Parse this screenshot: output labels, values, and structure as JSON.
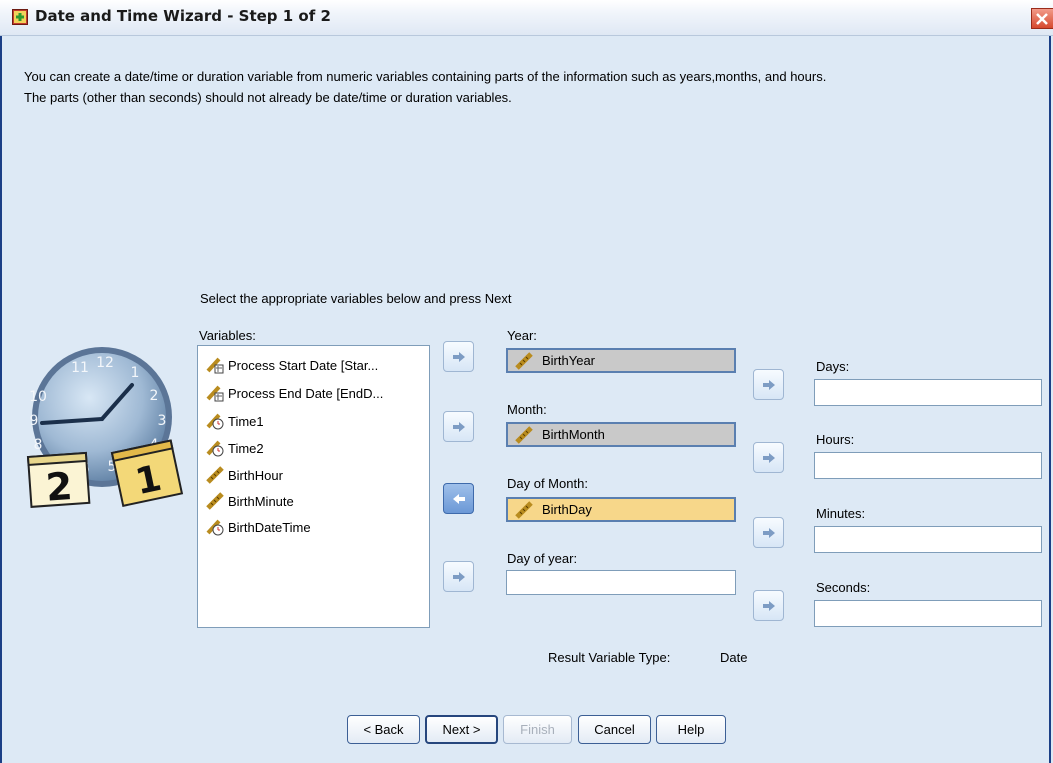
{
  "window": {
    "title": "Date and Time Wizard - Step 1 of 2"
  },
  "intro": {
    "line1": "You can create a date/time or duration variable from numeric variables containing parts of the information such as years,months, and hours.",
    "line2": "The parts (other than seconds) should not already be date/time or duration variables."
  },
  "instruction": "Select the appropriate variables below and press Next",
  "variables": {
    "label": "Variables:",
    "items": [
      {
        "label": "Process Start Date [Star...",
        "icon": "date-variable-icon"
      },
      {
        "label": "Process End Date [EndD...",
        "icon": "date-variable-icon"
      },
      {
        "label": "Time1",
        "icon": "time-variable-icon"
      },
      {
        "label": "Time2",
        "icon": "time-variable-icon"
      },
      {
        "label": "BirthHour",
        "icon": "scale-variable-icon"
      },
      {
        "label": "BirthMinute",
        "icon": "scale-variable-icon"
      },
      {
        "label": "BirthDateTime",
        "icon": "time-variable-icon"
      }
    ]
  },
  "fields": {
    "year": {
      "label": "Year:",
      "value": "BirthYear"
    },
    "month": {
      "label": "Month:",
      "value": "BirthMonth"
    },
    "day_of_month": {
      "label": "Day of Month:",
      "value": "BirthDay"
    },
    "day_of_year": {
      "label": "Day of year:",
      "value": ""
    },
    "days": {
      "label": "Days:",
      "value": ""
    },
    "hours": {
      "label": "Hours:",
      "value": ""
    },
    "minutes": {
      "label": "Minutes:",
      "value": ""
    },
    "seconds": {
      "label": "Seconds:",
      "value": ""
    }
  },
  "result": {
    "label": "Result Variable Type:",
    "value": "Date"
  },
  "buttons": {
    "back": "< Back",
    "next": "Next >",
    "finish": "Finish",
    "cancel": "Cancel",
    "help": "Help"
  },
  "colors": {
    "background": "#dde9f5",
    "selected_field": "#f7d78a",
    "filled_field": "#c9c9c9"
  }
}
